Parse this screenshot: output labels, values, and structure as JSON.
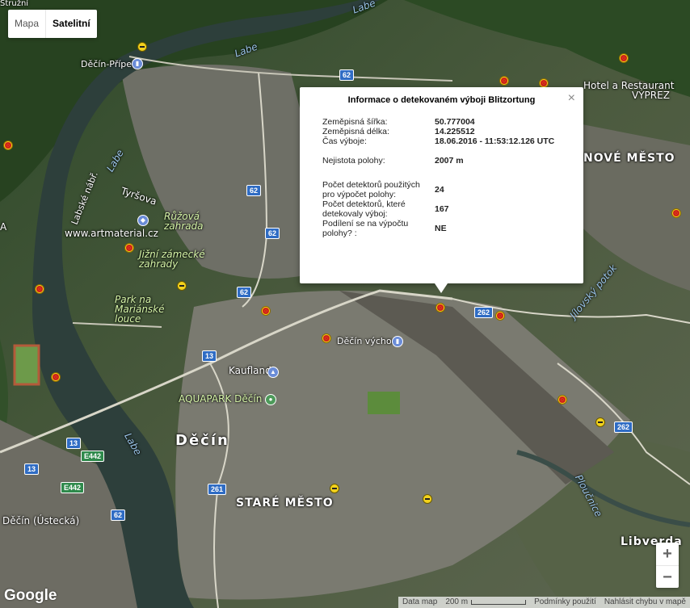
{
  "map_type": {
    "map_label": "Mapa",
    "satellite_label": "Satelitní",
    "active": "satellite"
  },
  "places": {
    "decin_priper": "Děčín-Přípeř",
    "hotel": "Hotel a Restaurant",
    "vypr": "VÝPREZ",
    "nove_mesto": "NOVÉ MĚSTO",
    "tyrsova": "Tyršova",
    "labska": "Labské nábř.",
    "artmaterial": "www.artmaterial.cz",
    "ruzova": "Růžová zahrada",
    "jizni": "Jižní zámecké zahrady",
    "park": "Park na Mariánské louce",
    "decin_vychod": "Děčín východ",
    "kaufland": "Kaufland",
    "aquapark": "AQUAPARK Děčín",
    "decin": "Děčín",
    "stare_mesto": "STARÉ MĚSTO",
    "decin_ustecka": "Děčín (Ústecká)",
    "libverda": "Libverda",
    "labe1": "Labe",
    "labe2": "Labe",
    "labe3": "Labe",
    "labe4": "Labe",
    "ploucnice": "Ploučnice",
    "jilovsky": "Jílovský potok",
    "a_edge": "A",
    "struzni": "Stružní"
  },
  "road_shields": [
    "62",
    "62",
    "62",
    "62",
    "13",
    "13",
    "13",
    "E442",
    "E442",
    "261",
    "262",
    "262",
    "62"
  ],
  "info_window": {
    "title": "Informace o detekovaném výboji Blitzortung",
    "close": "×",
    "rows": [
      {
        "label": "Zeměpisná šířka:",
        "value": "50.777004"
      },
      {
        "label": "Zeměpisná délka:",
        "value": "14.225512"
      },
      {
        "label": "Čas výboje:",
        "value": "18.06.2016 - 11:53:12.126 UTC"
      },
      {
        "label": "Nejistota polohy:",
        "value": "2007 m"
      },
      {
        "label": "Počet detektorů použitých pro výpočet polohy:",
        "value": "24"
      },
      {
        "label": "Počet detektorů, které detekovaly výboj:",
        "value": "167"
      },
      {
        "label": "Podílení se na výpočtu polohy? :",
        "value": "NE"
      }
    ]
  },
  "zoom": {
    "in": "+",
    "out": "−"
  },
  "footer": {
    "logo": "Google",
    "map_data": "Data map",
    "scale": "200 m",
    "terms": "Podmínky použití",
    "report": "Nahlásit chybu v mapě"
  },
  "colors": {
    "strike": "#f3d21c",
    "strike_cross": "#d0201a",
    "road_shield": "#2f6cc4"
  }
}
